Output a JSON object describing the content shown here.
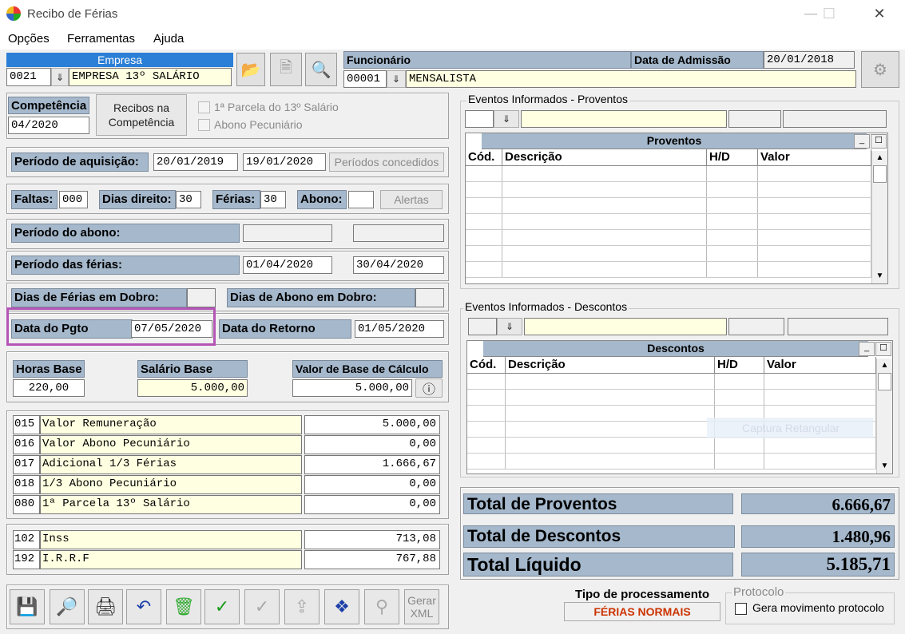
{
  "window": {
    "title": "Recibo de Férias",
    "minimize": "—",
    "maximize": "☐",
    "close": "✕"
  },
  "menu": [
    "Opções",
    "Ferramentas",
    "Ajuda"
  ],
  "empresa": {
    "label": "Empresa",
    "code": "0021",
    "name": "EMPRESA 13º SALÁRIO"
  },
  "funcionario": {
    "label": "Funcionário",
    "code": "00001",
    "name": "MENSALISTA",
    "admissao_label": "Data de Admissão",
    "admissao": "20/01/2018"
  },
  "competencia": {
    "label": "Competência",
    "value": "04/2020",
    "recibos_button": "Recibos na\nCompetência",
    "parcela13": "1ª Parcela do 13º Salário",
    "abono": "Abono Pecuniário"
  },
  "aquisicao": {
    "label": "Período de aquisição:",
    "inicio": "20/01/2019",
    "fim": "19/01/2020",
    "button": "Períodos concedidos"
  },
  "faltas": {
    "label": "Faltas:",
    "value": "000",
    "direito_label": "Dias direito:",
    "direito": "30",
    "ferias_label": "Férias:",
    "ferias": "30",
    "abono_label": "Abono:",
    "abono": "",
    "alertas": "Alertas"
  },
  "periodo_abono": {
    "label": "Período do abono:",
    "inicio": "",
    "fim": ""
  },
  "periodo_ferias": {
    "label": "Período das férias:",
    "inicio": "01/04/2020",
    "fim": "30/04/2020"
  },
  "dobro": {
    "ferias_label": "Dias de Férias em Dobro:",
    "ferias": "",
    "abono_label": "Dias de Abono em Dobro:",
    "abono": ""
  },
  "pagamento": {
    "pgto_label": "Data do Pgto",
    "pgto": "07/05/2020",
    "retorno_label": "Data do Retorno",
    "retorno": "01/05/2020"
  },
  "base": {
    "horas_label": "Horas Base",
    "horas": "220,00",
    "salario_label": "Salário Base",
    "salario": "5.000,00",
    "calculo_label": "Valor de Base de Cálculo",
    "calculo": "5.000,00"
  },
  "proventos_list": [
    {
      "code": "015",
      "desc": "Valor Remuneração",
      "value": "5.000,00"
    },
    {
      "code": "016",
      "desc": "Valor Abono Pecuniário",
      "value": "0,00"
    },
    {
      "code": "017",
      "desc": "Adicional 1/3 Férias",
      "value": "1.666,67"
    },
    {
      "code": "018",
      "desc": "1/3 Abono Pecuniário",
      "value": "0,00"
    },
    {
      "code": "080",
      "desc": "1ª Parcela 13º Salário",
      "value": "0,00"
    }
  ],
  "descontos_list": [
    {
      "code": "102",
      "desc": "Inss",
      "value": "713,08"
    },
    {
      "code": "192",
      "desc": "I.R.R.F",
      "value": "767,88"
    }
  ],
  "eventos_proventos": {
    "caption": "Eventos Informados - Proventos",
    "grid_title": "Proventos",
    "columns": [
      "Cód.",
      "Descrição",
      "H/D",
      "Valor"
    ]
  },
  "eventos_descontos": {
    "caption": "Eventos Informados - Descontos",
    "grid_title": "Descontos",
    "columns": [
      "Cód.",
      "Descrição",
      "H/D",
      "Valor"
    ],
    "ghost": "Captura Retangular"
  },
  "totais": {
    "proventos_label": "Total de Proventos",
    "proventos": "6.666,67",
    "descontos_label": "Total de Descontos",
    "descontos": "1.480,96",
    "liquido_label": "Total Líquido",
    "liquido": "5.185,71"
  },
  "processamento": {
    "label": "Tipo de processamento",
    "value": "FÉRIAS NORMAIS"
  },
  "protocolo": {
    "caption": "Protocolo",
    "checkbox": "Gera movimento protocolo"
  },
  "toolbar": {
    "gerar_xml": "Gerar\nXML"
  },
  "colors": {
    "label_bg": "#a5b8cc",
    "highlight": "#ffffe1",
    "pgto_outline": "#b455b6",
    "processamento": "#cc3300"
  }
}
